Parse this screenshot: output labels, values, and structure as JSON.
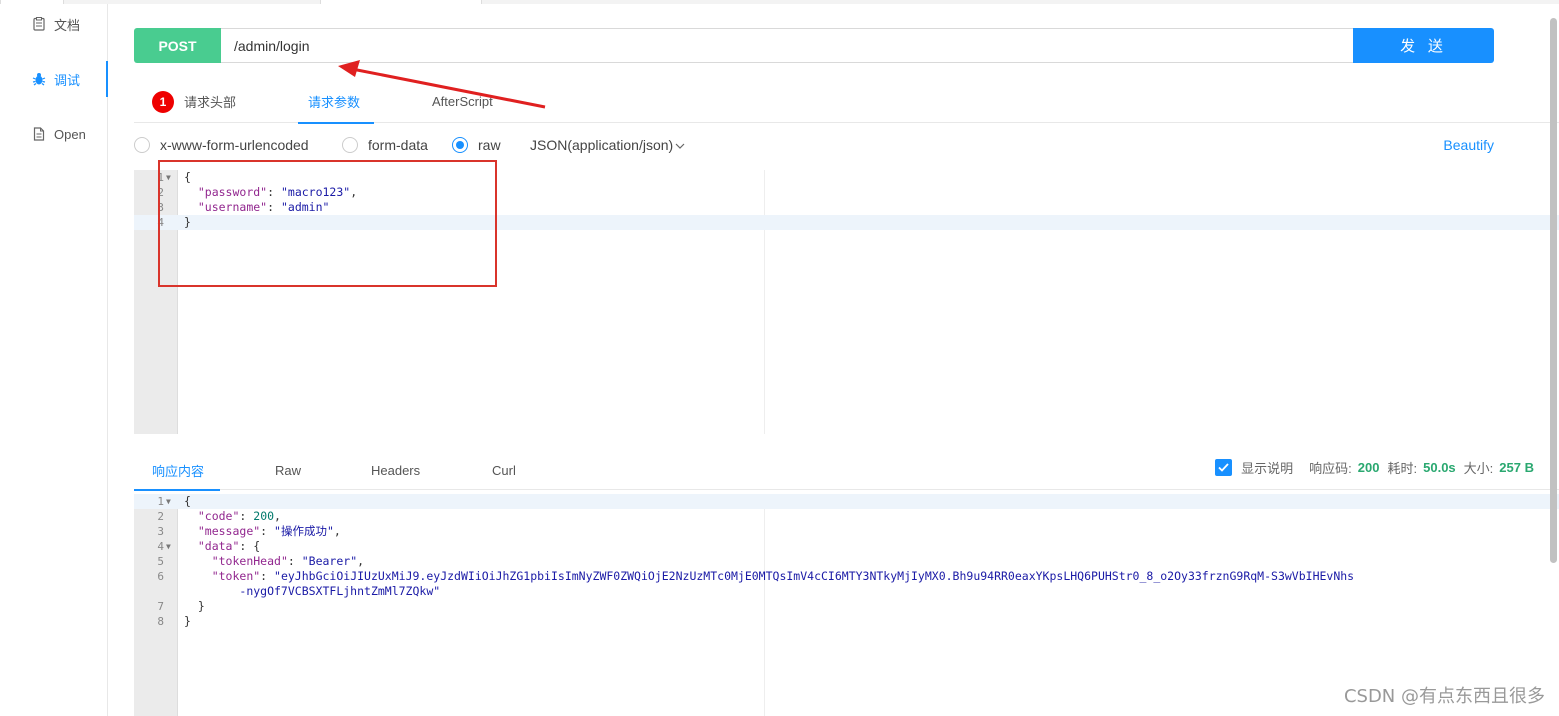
{
  "sidebar": {
    "items": [
      {
        "label": "文档",
        "icon": "document-icon",
        "active": false
      },
      {
        "label": "调试",
        "icon": "bug-icon",
        "active": true
      },
      {
        "label": "Open",
        "icon": "file-icon",
        "active": false
      }
    ]
  },
  "request": {
    "method": "POST",
    "url": "/admin/login",
    "send_label": "发 送",
    "method_color": "#49cc90",
    "accent_color": "#1890ff"
  },
  "request_tabs": [
    {
      "label": "请求头部",
      "badge": "1",
      "active": false
    },
    {
      "label": "请求参数",
      "active": true
    },
    {
      "label": "AfterScript",
      "active": false
    }
  ],
  "body_options": {
    "radios": [
      {
        "label": "x-www-form-urlencoded",
        "checked": false
      },
      {
        "label": "form-data",
        "checked": false
      },
      {
        "label": "raw",
        "checked": true
      }
    ],
    "content_type": "JSON(application/json)",
    "beautify_label": "Beautify"
  },
  "request_body": {
    "lines": [
      {
        "no": "1",
        "fold": true,
        "parts": [
          {
            "t": "{",
            "c": ""
          }
        ]
      },
      {
        "no": "2",
        "parts": [
          {
            "t": "  ",
            "c": ""
          },
          {
            "t": "\"password\"",
            "c": "k"
          },
          {
            "t": ": ",
            "c": ""
          },
          {
            "t": "\"macro123\"",
            "c": "s"
          },
          {
            "t": ",",
            "c": ""
          }
        ]
      },
      {
        "no": "3",
        "parts": [
          {
            "t": "  ",
            "c": ""
          },
          {
            "t": "\"username\"",
            "c": "k"
          },
          {
            "t": ": ",
            "c": ""
          },
          {
            "t": "\"admin\"",
            "c": "s"
          }
        ]
      },
      {
        "no": "4",
        "highlight": true,
        "parts": [
          {
            "t": "}",
            "c": ""
          }
        ]
      }
    ]
  },
  "response_tabs": [
    {
      "label": "响应内容",
      "active": true
    },
    {
      "label": "Raw",
      "active": false
    },
    {
      "label": "Headers",
      "active": false
    },
    {
      "label": "Curl",
      "active": false
    }
  ],
  "response_meta": {
    "show_desc_label": "显示说明",
    "show_desc_checked": true,
    "code_label": "响应码:",
    "code_value": "200",
    "time_label": "耗时:",
    "time_value": "50.0s",
    "size_label": "大小:",
    "size_value": "257 B"
  },
  "response_body": {
    "lines": [
      {
        "no": "1",
        "fold": true,
        "highlight": true,
        "parts": [
          {
            "t": "{",
            "c": ""
          }
        ]
      },
      {
        "no": "2",
        "parts": [
          {
            "t": "  ",
            "c": ""
          },
          {
            "t": "\"code\"",
            "c": "k"
          },
          {
            "t": ": ",
            "c": ""
          },
          {
            "t": "200",
            "c": "n"
          },
          {
            "t": ",",
            "c": ""
          }
        ]
      },
      {
        "no": "3",
        "parts": [
          {
            "t": "  ",
            "c": ""
          },
          {
            "t": "\"message\"",
            "c": "k"
          },
          {
            "t": ": ",
            "c": ""
          },
          {
            "t": "\"操作成功\"",
            "c": "s"
          },
          {
            "t": ",",
            "c": ""
          }
        ]
      },
      {
        "no": "4",
        "fold": true,
        "parts": [
          {
            "t": "  ",
            "c": ""
          },
          {
            "t": "\"data\"",
            "c": "k"
          },
          {
            "t": ": {",
            "c": ""
          }
        ]
      },
      {
        "no": "5",
        "parts": [
          {
            "t": "    ",
            "c": ""
          },
          {
            "t": "\"tokenHead\"",
            "c": "k"
          },
          {
            "t": ": ",
            "c": ""
          },
          {
            "t": "\"Bearer\"",
            "c": "s"
          },
          {
            "t": ",",
            "c": ""
          }
        ]
      },
      {
        "no": "6",
        "parts": [
          {
            "t": "    ",
            "c": ""
          },
          {
            "t": "\"token\"",
            "c": "k"
          },
          {
            "t": ": ",
            "c": ""
          },
          {
            "t": "\"eyJhbGciOiJIUzUxMiJ9.eyJzdWIiOiJhZG1pbiIsImNyZWF0ZWQiOjE2NzUzMTc0MjE0MTQsImV4cCI6MTY3NTkyMjIyMX0.Bh9u94RR0eaxYKpsLHQ6PUHStr0_8_o2Oy33frznG9RqM-S3wVbIHEvNhs",
            "c": "s"
          }
        ]
      },
      {
        "no": "",
        "parts": [
          {
            "t": "        ",
            "c": ""
          },
          {
            "t": "-nygOf7VCBSXTFLjhntZmMl7ZQkw\"",
            "c": "s"
          }
        ]
      },
      {
        "no": "7",
        "parts": [
          {
            "t": "  }",
            "c": ""
          }
        ]
      },
      {
        "no": "8",
        "parts": [
          {
            "t": "}",
            "c": ""
          }
        ]
      }
    ]
  },
  "watermark": "CSDN @有点东西且很多"
}
